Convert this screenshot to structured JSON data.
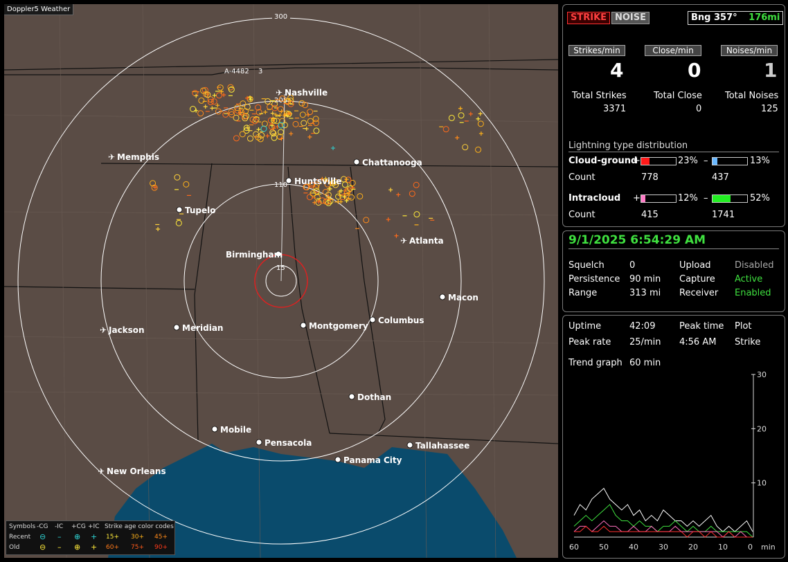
{
  "app": {
    "title": "Doppler5 Weather"
  },
  "map": {
    "range_labels": [
      "300",
      "205",
      "110",
      "15"
    ],
    "cities": [
      {
        "name": "Nashville",
        "airport": true
      },
      {
        "name": "Memphis",
        "airport": true
      },
      {
        "name": "Chattanooga",
        "airport": false
      },
      {
        "name": "Huntsville",
        "airport": false
      },
      {
        "name": "Tupelo",
        "airport": false
      },
      {
        "name": "Atlanta",
        "airport": true
      },
      {
        "name": "Birmingham",
        "airport": false
      },
      {
        "name": "Macon",
        "airport": false
      },
      {
        "name": "Jackson",
        "airport": true
      },
      {
        "name": "Meridian",
        "airport": false
      },
      {
        "name": "Montgomery",
        "airport": false
      },
      {
        "name": "Columbus",
        "airport": false
      },
      {
        "name": "Dothan",
        "airport": false
      },
      {
        "name": "Mobile",
        "airport": false
      },
      {
        "name": "Pensacola",
        "airport": false
      },
      {
        "name": "Tallahassee",
        "airport": false
      },
      {
        "name": "Panama City",
        "airport": false
      },
      {
        "name": "New Orleans",
        "airport": true
      }
    ],
    "marker_label": "A-4482",
    "marker_suffix": "3"
  },
  "legend": {
    "symbols": "Symbols",
    "col_ncg": "-CG",
    "col_nic": "-IC",
    "col_pcg": "+CG",
    "col_pic": "+IC",
    "age_title": "Strike age color codes",
    "recent": "Recent",
    "old": "Old",
    "age_r1": "15+",
    "age_r2": "30+",
    "age_r3": "45+",
    "age_o1": "60+",
    "age_o2": "75+",
    "age_o3": "90+"
  },
  "stats": {
    "strike_btn": "STRIKE",
    "noise_btn": "NOISE",
    "bearing": "Bng 357°",
    "distance": "176mi",
    "strikes_per_min_label": "Strikes/min",
    "close_per_min_label": "Close/min",
    "noises_per_min_label": "Noises/min",
    "strikes_per_min": "4",
    "close_per_min": "0",
    "noises_per_min": "1",
    "total_strikes_label": "Total Strikes",
    "total_close_label": "Total Close",
    "total_noises_label": "Total Noises",
    "total_strikes": "3371",
    "total_close": "0",
    "total_noises": "125",
    "dist_title": "Lightning type distribution",
    "cg_label": "Cloud-ground",
    "ic_label": "Intracloud",
    "count_label": "Count",
    "plus": "+",
    "minus": "–",
    "cg_pos_pct": "23%",
    "cg_neg_pct": "13%",
    "ic_pos_pct": "12%",
    "ic_neg_pct": "52%",
    "cg_pos_count": "778",
    "cg_neg_count": "437",
    "ic_pos_count": "415",
    "ic_neg_count": "1741",
    "cg_pos_frac": 0.23,
    "cg_neg_frac": 0.13,
    "ic_pos_frac": 0.12,
    "ic_neg_frac": 0.52
  },
  "status": {
    "datetime": "9/1/2025 6:54:29 AM",
    "squelch_label": "Squelch",
    "squelch": "0",
    "persistence_label": "Persistence",
    "persistence": "90 min",
    "range_label": "Range",
    "range": "313 mi",
    "upload_label": "Upload",
    "upload": "Disabled",
    "capture_label": "Capture",
    "capture": "Active",
    "receiver_label": "Receiver",
    "receiver": "Enabled"
  },
  "trend": {
    "uptime_label": "Uptime",
    "uptime": "42:09",
    "peak_time_label": "Peak time",
    "plot_label": "Plot",
    "peak_rate_label": "Peak rate",
    "peak_rate": "25/min",
    "peak_time": "4:56 AM",
    "plot": "Strike",
    "trend_label": "Trend graph",
    "trend_span": "60 min",
    "x_ticks": [
      "60",
      "50",
      "40",
      "30",
      "20",
      "10",
      "0"
    ],
    "x_unit": "min",
    "y_ticks": [
      "30",
      "20",
      "10"
    ]
  },
  "chart_data": {
    "type": "line",
    "x": [
      60,
      58,
      56,
      54,
      52,
      50,
      48,
      46,
      44,
      42,
      40,
      38,
      36,
      34,
      32,
      30,
      28,
      26,
      24,
      22,
      20,
      18,
      16,
      14,
      12,
      10,
      8,
      6,
      4,
      2,
      0
    ],
    "xlim": [
      60,
      0
    ],
    "ylim": [
      0,
      30
    ],
    "series": [
      {
        "color": "#ffffff",
        "values": [
          4,
          6,
          5,
          7,
          8,
          9,
          7,
          6,
          5,
          6,
          4,
          5,
          3,
          4,
          3,
          5,
          4,
          3,
          3,
          2,
          3,
          2,
          3,
          4,
          2,
          1,
          2,
          1,
          2,
          3,
          1
        ]
      },
      {
        "color": "#3fe03f",
        "values": [
          2,
          3,
          4,
          3,
          4,
          5,
          6,
          4,
          3,
          3,
          2,
          3,
          2,
          2,
          1,
          2,
          2,
          3,
          2,
          1,
          2,
          1,
          1,
          2,
          1,
          1,
          1,
          1,
          1,
          1,
          0
        ]
      },
      {
        "color": "#ff6fc0",
        "values": [
          1,
          2,
          2,
          1,
          2,
          3,
          2,
          2,
          1,
          1,
          2,
          1,
          1,
          2,
          1,
          1,
          1,
          2,
          1,
          1,
          1,
          1,
          1,
          1,
          1,
          0,
          1,
          0,
          1,
          0,
          0
        ]
      },
      {
        "color": "#ff3030",
        "values": [
          1,
          1,
          2,
          1,
          1,
          2,
          1,
          1,
          1,
          1,
          1,
          1,
          1,
          1,
          1,
          1,
          1,
          1,
          1,
          0,
          1,
          1,
          0,
          1,
          0,
          0,
          1,
          0,
          0,
          0,
          0
        ]
      }
    ]
  }
}
